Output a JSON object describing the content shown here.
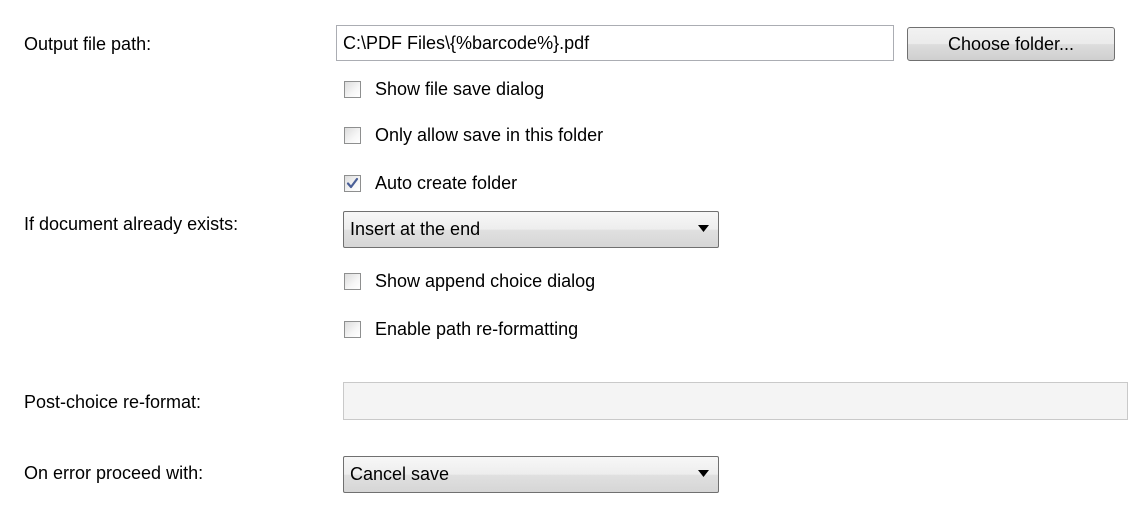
{
  "output_path": {
    "label": "Output file path:",
    "value": "C:\\PDF Files\\{%barcode%}.pdf",
    "choose_button": "Choose folder..."
  },
  "options": {
    "show_file_save_dialog": {
      "label": "Show file save dialog",
      "checked": false
    },
    "only_allow_save_in_folder": {
      "label": "Only allow save in this folder",
      "checked": false
    },
    "auto_create_folder": {
      "label": "Auto create folder",
      "checked": true
    }
  },
  "if_exists": {
    "label": "If document already exists:",
    "selected": "Insert at the end"
  },
  "append_options": {
    "show_append_choice_dialog": {
      "label": "Show append choice dialog",
      "checked": false
    },
    "enable_path_reformatting": {
      "label": "Enable path re-formatting",
      "checked": false
    }
  },
  "post_choice": {
    "label": "Post-choice re-format:",
    "value": ""
  },
  "on_error": {
    "label": "On error proceed with:",
    "selected": "Cancel save"
  },
  "icons": {
    "checkmark": "check-icon",
    "dropdown": "chevron-down-icon"
  },
  "colors": {
    "checkmark": "#4a5f97",
    "input_border": "#abadb3",
    "disabled_field": "#f4f4f4"
  }
}
